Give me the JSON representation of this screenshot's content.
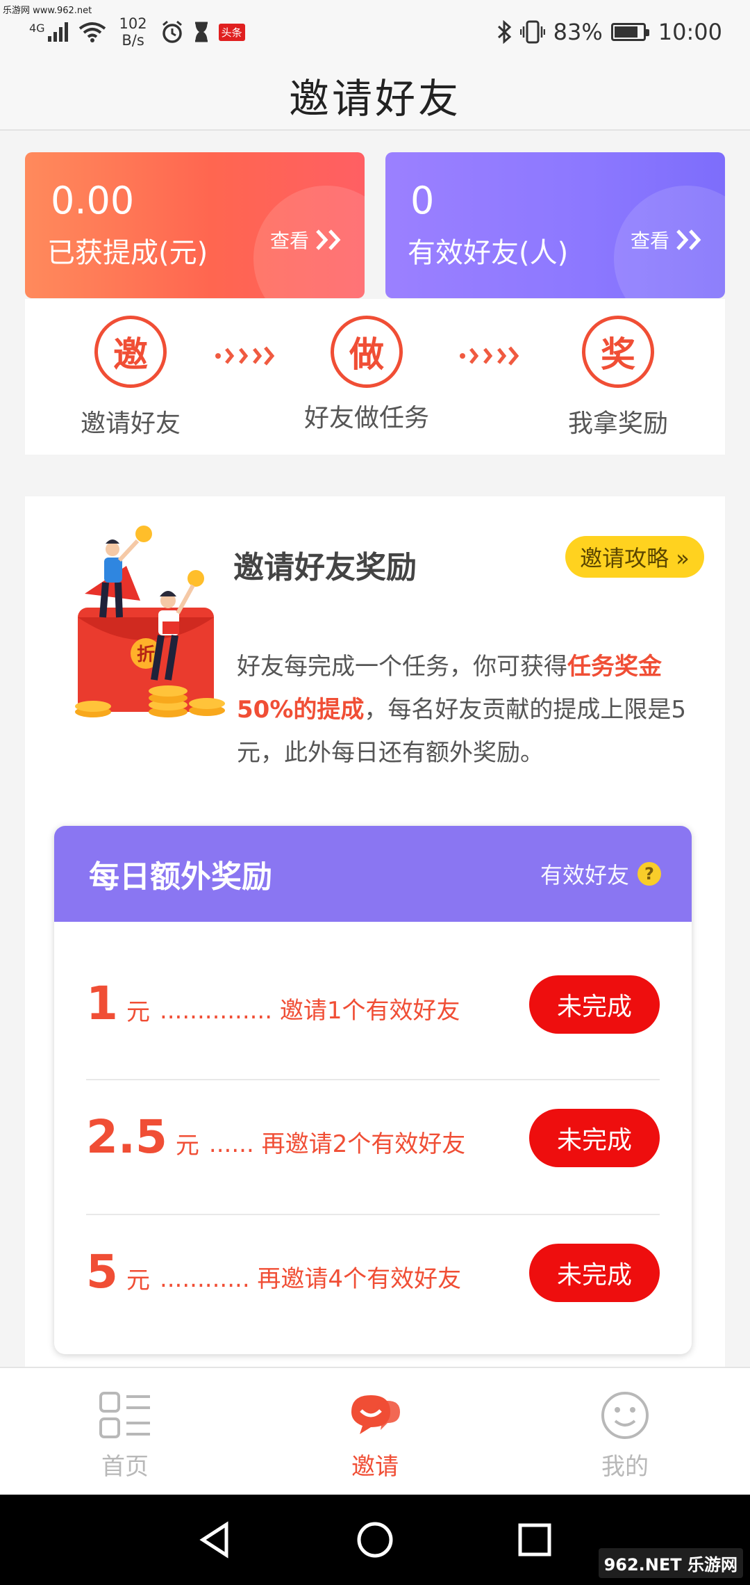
{
  "status_bar": {
    "watermark": "乐游网 www.962.net",
    "network": "4G",
    "speed": "102\nB/s",
    "speed_top": "102",
    "speed_bottom": "B/s",
    "news_badge": "头条",
    "battery_percent": "83%",
    "battery_level": 0.83,
    "time": "10:00"
  },
  "header": {
    "title": "邀请好友"
  },
  "stats": {
    "commission": {
      "value": "0.00",
      "label": "已获提成(元)",
      "view": "查看"
    },
    "friends": {
      "value": "0",
      "label": "有效好友(人)",
      "view": "查看"
    }
  },
  "steps": [
    {
      "char": "邀",
      "label": "邀请好友"
    },
    {
      "char": "做",
      "label": "好友做任务"
    },
    {
      "char": "奖",
      "label": "我拿奖励"
    }
  ],
  "reward": {
    "title": "邀请好友奖励",
    "strategy_button": "邀请攻略 »",
    "desc_part1": "好友每完成一个任务，你可获得",
    "desc_highlight": "任务奖金50%的提成",
    "desc_part2": "，每名好友贡献的提成上限是5元，此外每日还有额外奖励。",
    "illustration_coin": "折"
  },
  "daily": {
    "title": "每日额外奖励",
    "subtitle": "有效好友",
    "help": "?",
    "rows": [
      {
        "amount": "1",
        "unit": "元",
        "text": "............... 邀请1个有效好友",
        "status": "未完成"
      },
      {
        "amount": "2.5",
        "unit": "元",
        "text": "...... 再邀请2个有效好友",
        "status": "未完成"
      },
      {
        "amount": "5",
        "unit": "元",
        "text": "............ 再邀请4个有效好友",
        "status": "未完成"
      }
    ]
  },
  "nav": {
    "home": "首页",
    "invite": "邀请",
    "mine": "我的"
  },
  "site_mark": "962.NET 乐游网",
  "colors": {
    "accent": "#f04e35",
    "button_red": "#ee0e0e",
    "purple": "#8a76f2",
    "yellow": "#ffd21f"
  }
}
